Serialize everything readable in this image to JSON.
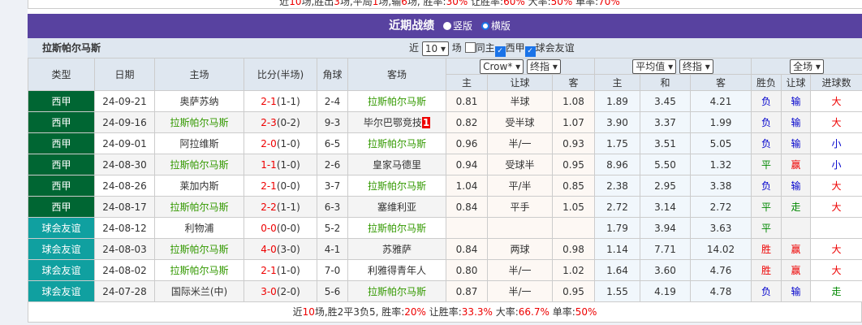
{
  "top_summary": {
    "prefix": "近",
    "n": "10",
    "a": "场,胜出",
    "w": "3",
    "b": "场,平局",
    "d": "1",
    "c": "场,输",
    "l": "6",
    "e": "场, 胜率:",
    "wr": "30%",
    "f": " 让胜率:",
    "hr": "60%",
    "g": " 大率:",
    "br": "50%",
    "h": " 单率:",
    "or": "70%"
  },
  "section": {
    "title": "近期战绩",
    "opt1": "竖版",
    "opt2": "横版"
  },
  "filter": {
    "team": "拉斯帕尔马斯",
    "near": "近",
    "count": "10",
    "unit": "场",
    "same_home": "同主",
    "league1": "西甲",
    "league2": "球会友谊"
  },
  "headers": {
    "type": "类型",
    "date": "日期",
    "home": "主场",
    "score": "比分(半场)",
    "corner": "角球",
    "away": "客场",
    "company": "Crow*",
    "odds1": "终指",
    "avg": "平均值",
    "odds2": "终指",
    "scope": "全场",
    "h_main": "主",
    "h_line": "让球",
    "h_away": "客",
    "e_main": "主",
    "e_draw": "和",
    "e_away": "客",
    "res": "胜负",
    "hres": "让球",
    "goals": "进球数"
  },
  "rows": [
    {
      "type": "西甲",
      "tc": 1,
      "date": "24-09-21",
      "home": "奥萨苏纳",
      "hg": 0,
      "ft": "2-1",
      "ht": "(1-1)",
      "corner": "2-4",
      "away": "拉斯帕尔马斯",
      "ag": 1,
      "badge": "",
      "m": "0.81",
      "line": "半球",
      "aw": "1.08",
      "e1": "1.89",
      "e2": "3.45",
      "e3": "4.21",
      "res": "负",
      "hres": "输",
      "goals": "大"
    },
    {
      "type": "西甲",
      "tc": 1,
      "date": "24-09-16",
      "home": "拉斯帕尔马斯",
      "hg": 1,
      "ft": "2-3",
      "ht": "(0-2)",
      "corner": "9-3",
      "away": "毕尔巴鄂竞技",
      "ag": 0,
      "badge": "1",
      "m": "0.82",
      "line": "受半球",
      "aw": "1.07",
      "e1": "3.90",
      "e2": "3.37",
      "e3": "1.99",
      "res": "负",
      "hres": "输",
      "goals": "大"
    },
    {
      "type": "西甲",
      "tc": 1,
      "date": "24-09-01",
      "home": "阿拉维斯",
      "hg": 0,
      "ft": "2-0",
      "ht": "(1-0)",
      "corner": "6-5",
      "away": "拉斯帕尔马斯",
      "ag": 1,
      "badge": "",
      "m": "0.96",
      "line": "半/一",
      "aw": "0.93",
      "e1": "1.75",
      "e2": "3.51",
      "e3": "5.05",
      "res": "负",
      "hres": "输",
      "goals": "小"
    },
    {
      "type": "西甲",
      "tc": 1,
      "date": "24-08-30",
      "home": "拉斯帕尔马斯",
      "hg": 1,
      "ft": "1-1",
      "ht": "(1-0)",
      "corner": "2-6",
      "away": "皇家马德里",
      "ag": 0,
      "badge": "",
      "m": "0.94",
      "line": "受球半",
      "aw": "0.95",
      "e1": "8.96",
      "e2": "5.50",
      "e3": "1.32",
      "res": "平",
      "hres": "赢",
      "goals": "小"
    },
    {
      "type": "西甲",
      "tc": 1,
      "date": "24-08-26",
      "home": "莱加内斯",
      "hg": 0,
      "ft": "2-1",
      "ht": "(0-0)",
      "corner": "3-7",
      "away": "拉斯帕尔马斯",
      "ag": 1,
      "badge": "",
      "m": "1.04",
      "line": "平/半",
      "aw": "0.85",
      "e1": "2.38",
      "e2": "2.95",
      "e3": "3.38",
      "res": "负",
      "hres": "输",
      "goals": "大"
    },
    {
      "type": "西甲",
      "tc": 1,
      "date": "24-08-17",
      "home": "拉斯帕尔马斯",
      "hg": 1,
      "ft": "2-2",
      "ht": "(1-1)",
      "corner": "6-3",
      "away": "塞维利亚",
      "ag": 0,
      "badge": "",
      "m": "0.84",
      "line": "平手",
      "aw": "1.05",
      "e1": "2.72",
      "e2": "3.14",
      "e3": "2.72",
      "res": "平",
      "hres": "走",
      "goals": "大"
    },
    {
      "type": "球会友谊",
      "tc": 2,
      "date": "24-08-12",
      "home": "利物浦",
      "hg": 0,
      "ft": "0-0",
      "ht": "(0-0)",
      "corner": "5-2",
      "away": "拉斯帕尔马斯",
      "ag": 1,
      "badge": "",
      "m": "",
      "line": "",
      "aw": "",
      "e1": "1.79",
      "e2": "3.94",
      "e3": "3.63",
      "res": "平",
      "hres": "",
      "goals": ""
    },
    {
      "type": "球会友谊",
      "tc": 2,
      "date": "24-08-03",
      "home": "拉斯帕尔马斯",
      "hg": 1,
      "ft": "4-0",
      "ht": "(3-0)",
      "corner": "4-1",
      "away": "苏雅萨",
      "ag": 0,
      "badge": "",
      "m": "0.84",
      "line": "两球",
      "aw": "0.98",
      "e1": "1.14",
      "e2": "7.71",
      "e3": "14.02",
      "res": "胜",
      "hres": "赢",
      "goals": "大"
    },
    {
      "type": "球会友谊",
      "tc": 2,
      "date": "24-08-02",
      "home": "拉斯帕尔马斯",
      "hg": 1,
      "ft": "2-1",
      "ht": "(1-0)",
      "corner": "7-0",
      "away": "利雅得青年人",
      "ag": 0,
      "badge": "",
      "m": "0.80",
      "line": "半/一",
      "aw": "1.02",
      "e1": "1.64",
      "e2": "3.60",
      "e3": "4.76",
      "res": "胜",
      "hres": "赢",
      "goals": "大"
    },
    {
      "type": "球会友谊",
      "tc": 2,
      "date": "24-07-28",
      "home": "国际米兰(中)",
      "hg": 0,
      "ft": "3-0",
      "ht": "(2-0)",
      "corner": "5-6",
      "away": "拉斯帕尔马斯",
      "ag": 1,
      "badge": "",
      "m": "0.87",
      "line": "半/一",
      "aw": "0.95",
      "e1": "1.55",
      "e2": "4.19",
      "e3": "4.78",
      "res": "负",
      "hres": "输",
      "goals": "走"
    }
  ],
  "footer": {
    "a": "近",
    "n": "10",
    "b": "场,胜2平3负5, 胜率:",
    "wr": "20%",
    "c": " 让胜率:",
    "hr": "33.3%",
    "d": " 大率:",
    "br": "66.7%",
    "e": " 单率:",
    "or": "50%"
  },
  "colors": {
    "header_purple": "#5842a0",
    "league_green": "#006633",
    "friendly_teal": "#10a0a0",
    "win_red": "#e00000",
    "lose_blue": "#0000cc",
    "draw_green": "#008800",
    "team_green": "#339900"
  }
}
